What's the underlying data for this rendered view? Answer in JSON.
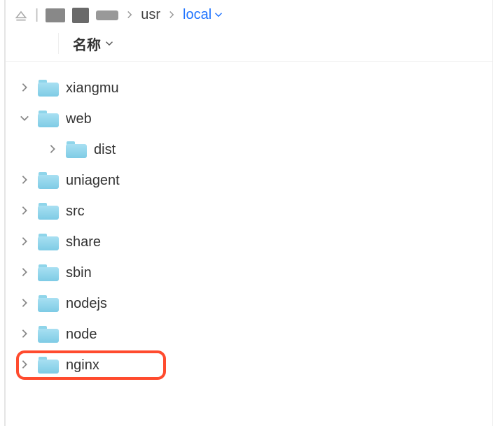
{
  "breadcrumb": {
    "path_item_1": "usr",
    "path_current": "local"
  },
  "column_header": "名称",
  "folders": [
    {
      "name": "xiangmu",
      "expanded": false,
      "highlighted": false,
      "children": []
    },
    {
      "name": "web",
      "expanded": true,
      "highlighted": false,
      "children": [
        {
          "name": "dist",
          "expanded": false
        }
      ]
    },
    {
      "name": "uniagent",
      "expanded": false,
      "highlighted": false,
      "children": []
    },
    {
      "name": "src",
      "expanded": false,
      "highlighted": false,
      "children": []
    },
    {
      "name": "share",
      "expanded": false,
      "highlighted": false,
      "children": []
    },
    {
      "name": "sbin",
      "expanded": false,
      "highlighted": false,
      "children": []
    },
    {
      "name": "nodejs",
      "expanded": false,
      "highlighted": false,
      "children": []
    },
    {
      "name": "node",
      "expanded": false,
      "highlighted": false,
      "children": []
    },
    {
      "name": "nginx",
      "expanded": false,
      "highlighted": true,
      "children": []
    }
  ]
}
